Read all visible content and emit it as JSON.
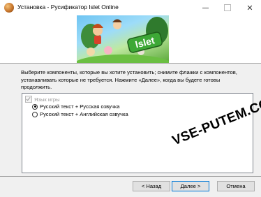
{
  "window": {
    "title": "Установка - Русификатор Islet Online"
  },
  "banner": {
    "logo_text": "Islet"
  },
  "description": "Выберите компоненты, которые вы хотите установить; снимите флажки с компонентов, устанавливать которые не требуется. Нажмите «Далее», когда вы будете готовы продолжить.",
  "components": {
    "category": {
      "label": "Язык игры",
      "checked": true,
      "disabled": true
    },
    "options": [
      {
        "label": "Русский текст + Русская озвучка",
        "selected": true
      },
      {
        "label": "Русский текст + Английская озвучка",
        "selected": false
      }
    ]
  },
  "watermark": "VSE-PUTEM.COM",
  "buttons": {
    "back": "< Назад",
    "next": "Далее >",
    "cancel": "Отмена"
  }
}
